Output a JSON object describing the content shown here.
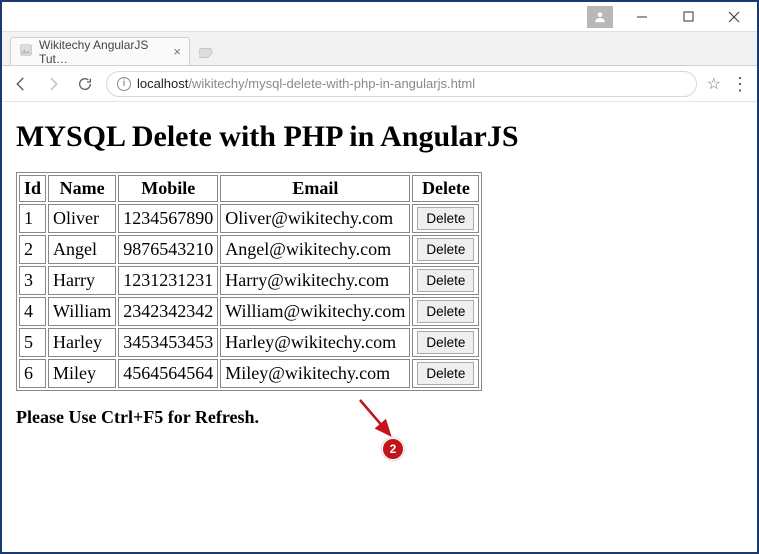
{
  "window": {
    "user_icon": "user"
  },
  "tab": {
    "title": "Wikitechy AngularJS Tut…"
  },
  "address": {
    "host": "localhost",
    "path": "/wikitechy/mysql-delete-with-php-in-angularjs.html"
  },
  "page": {
    "heading": "MYSQL Delete with PHP in AngularJS",
    "refresh_msg": "Please Use Ctrl+F5 for Refresh."
  },
  "table": {
    "headers": {
      "id": "Id",
      "name": "Name",
      "mobile": "Mobile",
      "email": "Email",
      "delete": "Delete"
    },
    "delete_label": "Delete",
    "rows": [
      {
        "id": "1",
        "name": "Oliver",
        "mobile": "1234567890",
        "email": "Oliver@wikitechy.com"
      },
      {
        "id": "2",
        "name": "Angel",
        "mobile": "9876543210",
        "email": "Angel@wikitechy.com"
      },
      {
        "id": "3",
        "name": "Harry",
        "mobile": "1231231231",
        "email": "Harry@wikitechy.com"
      },
      {
        "id": "4",
        "name": "William",
        "mobile": "2342342342",
        "email": "William@wikitechy.com"
      },
      {
        "id": "5",
        "name": "Harley",
        "mobile": "3453453453",
        "email": "Harley@wikitechy.com"
      },
      {
        "id": "6",
        "name": "Miley",
        "mobile": "4564564564",
        "email": "Miley@wikitechy.com"
      }
    ]
  },
  "annotation": {
    "badge": "2"
  }
}
